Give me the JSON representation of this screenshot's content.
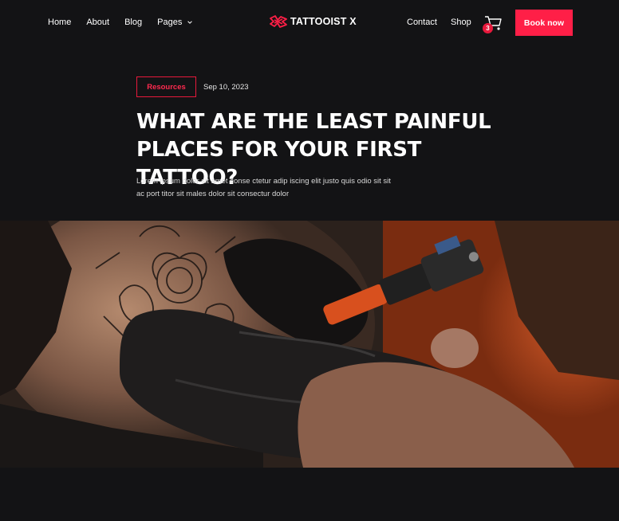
{
  "nav": {
    "left": [
      {
        "label": "Home"
      },
      {
        "label": "About"
      },
      {
        "label": "Blog"
      },
      {
        "label": "Pages",
        "dropdown": true
      }
    ],
    "logo_text": "TATTOOIST X",
    "contact_label": "Contact",
    "shop_label": "Shop",
    "cart_count": "3",
    "book_label": "Book now"
  },
  "post": {
    "category": "Resources",
    "date": "Sep 10, 2023",
    "title": "WHAT ARE THE LEAST PAINFUL PLACES FOR YOUR FIRST TATTOO?",
    "excerpt": "Lorem ipsum dolor sit amet conse ctetur adip iscing elit justo quis odio sit sit ac port titor sit males dolor sit consectur dolor"
  },
  "colors": {
    "background": "#131315",
    "accent": "#ff1f47"
  },
  "icons": {
    "cart": "cart-icon",
    "logo": "logo-mark-icon",
    "dropdown": "chevron-down-icon"
  }
}
